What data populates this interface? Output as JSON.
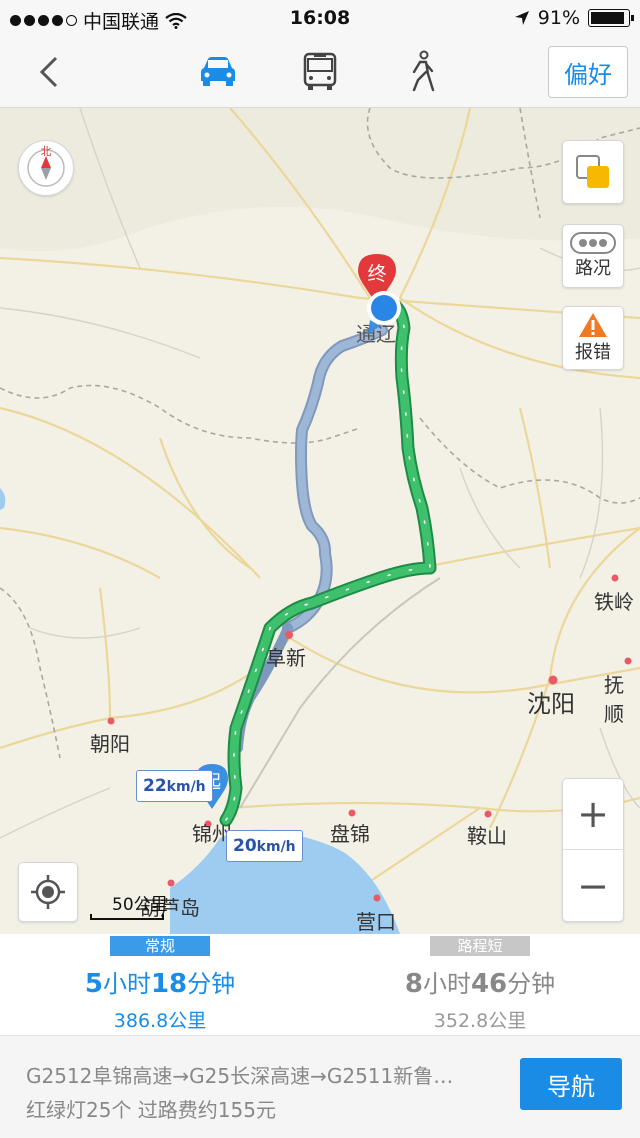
{
  "status_bar": {
    "carrier": "中国联通",
    "time": "16:08",
    "battery": "91%",
    "battery_level": 0.91
  },
  "nav": {
    "back_icon": "chevron-left-icon",
    "modes": [
      {
        "name": "car-icon",
        "active": true
      },
      {
        "name": "bus-icon",
        "active": false
      },
      {
        "name": "walk-icon",
        "active": false
      }
    ],
    "preference_label": "偏好"
  },
  "map": {
    "compass_label": "北",
    "layers_icon": "layers-icon",
    "traffic_label": "路况",
    "report_label": "报错",
    "zoom_in": "+",
    "zoom_out": "−",
    "scale_label": "50公里",
    "end_marker": "终",
    "start_marker": "起",
    "speed_tags": [
      {
        "value": "22",
        "unit": "km/h"
      },
      {
        "value": "20",
        "unit": "km/h"
      }
    ],
    "cities": {
      "fuxin": "阜新",
      "chaoyang": "朝阳",
      "jinzhou": "锦州",
      "huludao": "葫芦岛",
      "panjin": "盘锦",
      "anshan": "鞍山",
      "yingkou": "营口",
      "shenyang": "沈阳",
      "tieling": "铁岭",
      "fushun": "抚顺",
      "tongliao": "通辽"
    },
    "colors": {
      "main_route": "#2db45e",
      "alt_route": "#8fa9cc",
      "water": "#9ecbf0",
      "marker_end": "#e4393c",
      "marker_start": "#3b8fe0"
    }
  },
  "routes": [
    {
      "tag": "常规",
      "hours": "5",
      "mins": "18",
      "hour_unit": "小时",
      "min_unit": "分钟",
      "distance": "386.8公里",
      "selected": true,
      "tag_color": "#3b9be8"
    },
    {
      "tag": "路程短",
      "hours": "8",
      "mins": "46",
      "hour_unit": "小时",
      "min_unit": "分钟",
      "distance": "352.8公里",
      "selected": false,
      "tag_color": "#c7c7c7"
    }
  ],
  "bottom": {
    "road_summary": "G2512阜锦高速→G25长深高速→G2511新鲁…",
    "traffic_info": "红绿灯25个  过路费约155元",
    "navigate_label": "导航"
  }
}
